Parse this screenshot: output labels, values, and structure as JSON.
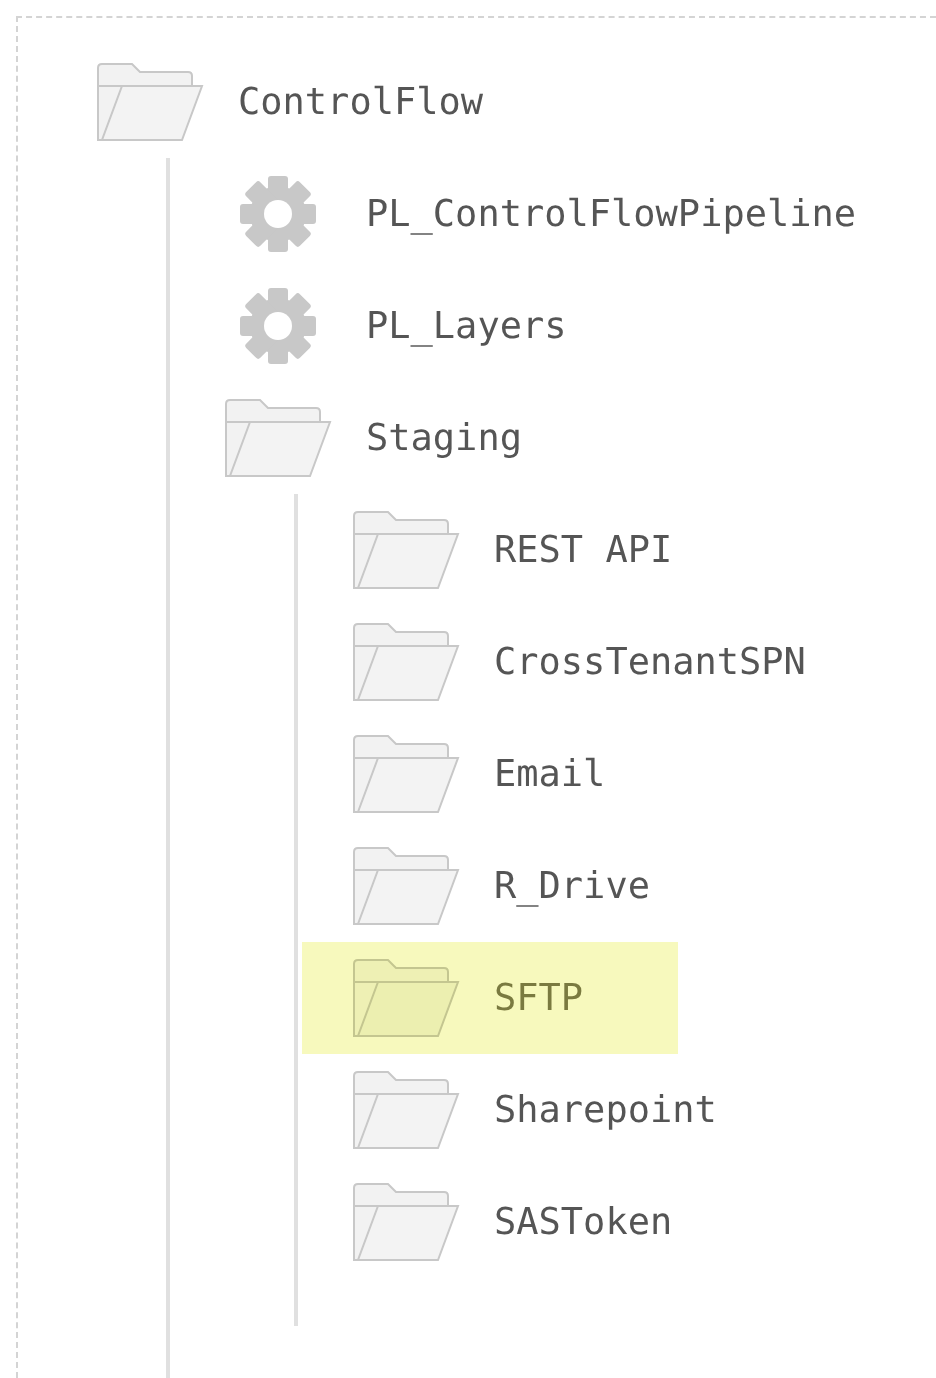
{
  "tree": [
    {
      "kind": "folder",
      "label": "ControlFlow",
      "selected": false,
      "children": [
        {
          "kind": "pipeline",
          "label": "PL_ControlFlowPipeline",
          "selected": false
        },
        {
          "kind": "pipeline",
          "label": "PL_Layers",
          "selected": false
        },
        {
          "kind": "folder",
          "label": "Staging",
          "selected": false,
          "children": [
            {
              "kind": "folder",
              "label": "REST API",
              "selected": false
            },
            {
              "kind": "folder",
              "label": "CrossTenantSPN",
              "selected": false
            },
            {
              "kind": "folder",
              "label": "Email",
              "selected": false
            },
            {
              "kind": "folder",
              "label": "R_Drive",
              "selected": false
            },
            {
              "kind": "folder",
              "label": "SFTP",
              "selected": true
            },
            {
              "kind": "folder",
              "label": "Sharepoint",
              "selected": false
            },
            {
              "kind": "folder",
              "label": "SASToken",
              "selected": false
            }
          ]
        }
      ]
    }
  ]
}
